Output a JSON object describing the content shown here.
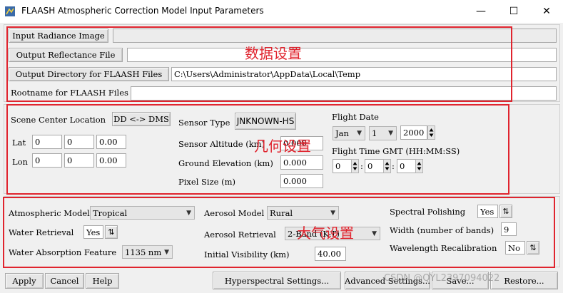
{
  "window": {
    "title": "FLAASH Atmospheric Correction Model Input Parameters",
    "minimize_glyph": "—",
    "maximize_glyph": "☐",
    "close_glyph": "✕",
    "icon": "envi-app-icon"
  },
  "data_section": {
    "input_radiance_button": "Input Radiance Image",
    "input_radiance_value": "",
    "output_reflectance_button": "Output Reflectance File",
    "output_reflectance_value": "",
    "output_directory_button": "Output Directory for FLAASH Files",
    "output_directory_value": "C:\\Users\\Administrator\\AppData\\Local\\Temp",
    "rootname_label": "Rootname for FLAASH Files",
    "rootname_value": "",
    "annotation": "数据设置"
  },
  "geometry_section": {
    "scene_center_label": "Scene Center Location",
    "dd_dms_button": "DD <-> DMS",
    "lat_label": "Lat",
    "lat_values": [
      "0",
      "0",
      "0.00"
    ],
    "lon_label": "Lon",
    "lon_values": [
      "0",
      "0",
      "0.00"
    ],
    "sensor_type_label": "Sensor Type",
    "sensor_type_value": "JNKNOWN-HS",
    "sensor_altitude_label": "Sensor Altitude (km)",
    "sensor_altitude_value": "0.000",
    "ground_elevation_label": "Ground Elevation (km)",
    "ground_elevation_value": "0.000",
    "pixel_size_label": "Pixel Size (m)",
    "pixel_size_value": "0.000",
    "flight_date_label": "Flight Date",
    "month_value": "Jan",
    "day_value": "1",
    "year_value": "2000",
    "flight_time_label": "Flight Time GMT (HH:MM:SS)",
    "time_values": [
      "0",
      "0",
      "0"
    ],
    "time_separator": ":",
    "annotation": "几何设置"
  },
  "atmosphere_section": {
    "atmospheric_model_label": "Atmospheric Model",
    "atmospheric_model_value": "Tropical",
    "water_retrieval_label": "Water Retrieval",
    "water_retrieval_value": "Yes",
    "water_absorption_label": "Water Absorption Feature",
    "water_absorption_value": "1135 nm",
    "aerosol_model_label": "Aerosol Model",
    "aerosol_model_value": "Rural",
    "aerosol_retrieval_label": "Aerosol Retrieval",
    "aerosol_retrieval_value": "2-Band (K-T)",
    "initial_visibility_label": "Initial Visibility (km)",
    "initial_visibility_value": "40.00",
    "spectral_polishing_label": "Spectral Polishing",
    "spectral_polishing_value": "Yes",
    "width_label": "Width (number of bands)",
    "width_value": "9",
    "wavelength_recal_label": "Wavelength Recalibration",
    "wavelength_recal_value": "No",
    "toggle_glyph": "⇅",
    "annotation": "大气设置"
  },
  "bottom_bar": {
    "apply": "Apply",
    "cancel": "Cancel",
    "help": "Help",
    "hyperspectral": "Hyperspectral Settings...",
    "advanced": "Advanced Settings...",
    "save": "Save...",
    "restore": "Restore..."
  },
  "watermark": "CSDN @QYL2397094022",
  "colors": {
    "annotation_red": "#e0242e",
    "window_bg": "#f0f0f0",
    "field_bg": "#ffffff"
  }
}
